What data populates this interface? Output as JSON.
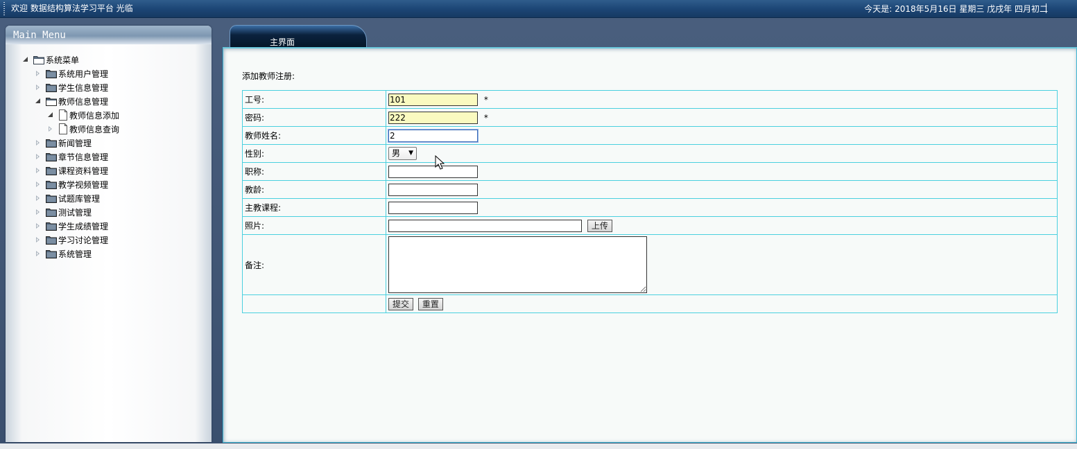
{
  "header": {
    "welcome": "欢迎 数据结构算法学习平台 光临",
    "datetime": "今天是: 2018年5月16日 星期三 戊戌年 四月初二"
  },
  "sidebar": {
    "title": "Main Menu",
    "root": "系统菜单",
    "items": [
      {
        "label": "系统用户管理"
      },
      {
        "label": "学生信息管理"
      },
      {
        "label": "教师信息管理"
      },
      {
        "label": "教师信息添加"
      },
      {
        "label": "教师信息查询"
      },
      {
        "label": "新闻管理"
      },
      {
        "label": "章节信息管理"
      },
      {
        "label": "课程资料管理"
      },
      {
        "label": "教学视频管理"
      },
      {
        "label": "试题库管理"
      },
      {
        "label": "测试管理"
      },
      {
        "label": "学生成绩管理"
      },
      {
        "label": "学习讨论管理"
      },
      {
        "label": "系统管理"
      }
    ]
  },
  "tab": {
    "label": "主界面"
  },
  "form": {
    "title": "添加教师注册:",
    "required_mark": "*",
    "fields": {
      "id": {
        "label": "工号:",
        "value": "101"
      },
      "password": {
        "label": "密码:",
        "value": "222"
      },
      "name": {
        "label": "教师姓名:",
        "value": "2"
      },
      "gender": {
        "label": "性别:",
        "value": "男"
      },
      "title": {
        "label": "职称:",
        "value": ""
      },
      "years": {
        "label": "教龄:",
        "value": ""
      },
      "course": {
        "label": "主教课程:",
        "value": ""
      },
      "photo": {
        "label": "照片:",
        "value": "",
        "upload_label": "上传"
      },
      "remark": {
        "label": "备注:",
        "value": ""
      }
    },
    "submit_label": "提交",
    "reset_label": "重置"
  }
}
